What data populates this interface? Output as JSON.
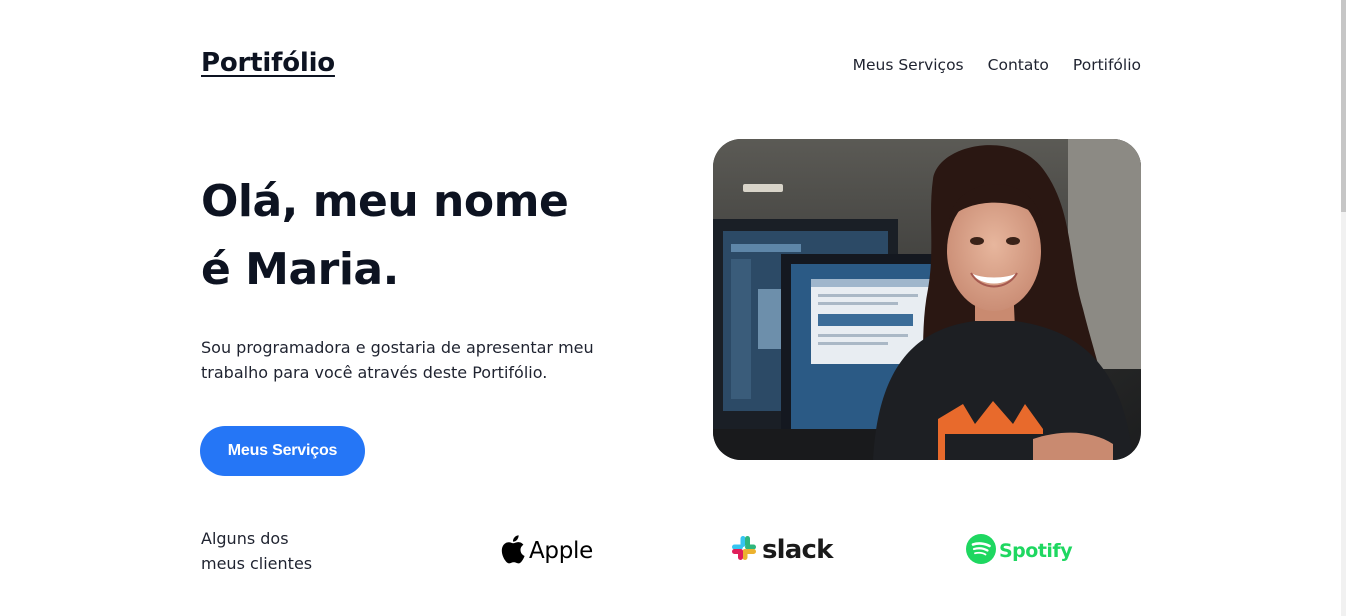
{
  "header": {
    "logo": "Portifólio",
    "nav": [
      "Meus Serviços",
      "Contato",
      "Portifólio"
    ]
  },
  "hero": {
    "title_line1": "Olá, meu nome",
    "title_line2": "é Maria.",
    "description_line1": "Sou programadora e gostaria de apresentar meu",
    "description_line2": "trabalho para você através deste Portifólio.",
    "cta_label": "Meus Serviços"
  },
  "clients": {
    "label_line1": "Alguns dos",
    "label_line2": "meus clientes",
    "logos": [
      {
        "name": "Apple",
        "icon": "apple-icon"
      },
      {
        "name": "slack",
        "icon": "slack-icon"
      },
      {
        "name": "Spotify",
        "icon": "spotify-icon"
      }
    ]
  },
  "colors": {
    "accent": "#2576f6",
    "text": "#0d1321",
    "spotify": "#1ed760"
  }
}
